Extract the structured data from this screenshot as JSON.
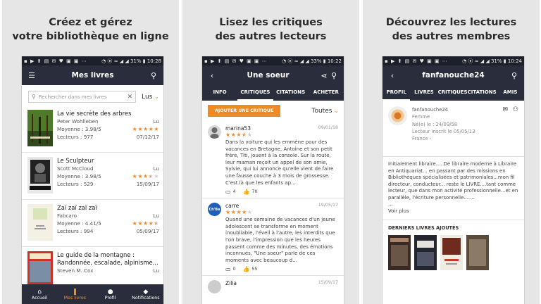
{
  "panels": [
    {
      "caption": [
        "Créez et gérez",
        "votre bibliothèque en ligne"
      ],
      "status": {
        "left": "▪ ▶ ⬆ ▤ ✉ ♥ ▣ ▣ ⋯",
        "right": "◔ ⦿ ≈ ◢ ◢ 31% ▮ 10:28"
      },
      "appbar_title": "Mes livres",
      "search_placeholder": "Rechercher dans mes livres",
      "filter": "Lus",
      "books": [
        {
          "title": "La vie secrète des arbres",
          "author": "Peter Wohlleben",
          "status": "Lu",
          "avg_label": "Moyenne : 3.98/5",
          "rating": 5,
          "readers_label": "Lecteurs : 977",
          "date": "07/12/17"
        },
        {
          "title": "Le Sculpteur",
          "author": "Scott McCloud",
          "status": "Lu",
          "avg_label": "Moyenne : 3.98/5",
          "rating": 3.5,
          "readers_label": "Lecteurs : 529",
          "date": "15/09/17"
        },
        {
          "title": "Zaï zaï zaï zaï",
          "author": "Fabcaro",
          "status": "Lu",
          "avg_label": "Moyenne : 4.41/5",
          "rating": 4.5,
          "readers_label": "Lecteurs : 994",
          "date": "05/09/17"
        },
        {
          "title": "Le guide de la montagne :",
          "title2": "Randonnée, escalade, alpinisme...",
          "author": "Steven M. Cox",
          "status": "Lu"
        }
      ],
      "nav": [
        {
          "icon": "⌂",
          "label": "Accueil"
        },
        {
          "icon": "❚",
          "label": "Mes livres"
        },
        {
          "icon": "●",
          "label": "Profil"
        },
        {
          "icon": "◆",
          "label": "Notifications"
        }
      ]
    },
    {
      "caption": [
        "Lisez les critiques",
        "des autres lecteurs"
      ],
      "status": {
        "left": "▪ ▶ ⬆ ▤ ✉ ♥ ▣ ▣ ⋯",
        "right": "◔ ⦿ ≈ ◢ ◢ 33% ▮ 10:22"
      },
      "appbar_title": "Une soeur",
      "tabs": [
        "INFO",
        "CRITIQUES",
        "CITATIONS",
        "ACHETER"
      ],
      "add_button": "AJOUTER UNE CRITIQUE",
      "filter": "Toutes",
      "reviews": [
        {
          "user": "marina53",
          "date": "09/01/18",
          "rating": 3.5,
          "text": "Dans la voiture qui les emmène pour des vacances en Bretagne, Antoine et son petit frère, Titi, jouent à la console. Sur la route, leur maman reçoit un appel de son amie, Sylvie, qui lui annonce qu'elle vient de faire une fausse couche à 3 mois de grossesse. C'est là que les enfants ap...",
          "comments": "4",
          "likes": "70"
        },
        {
          "user": "carre",
          "date": "19/05/17",
          "rating": 4,
          "avatar_text": "Ch'Ba",
          "text": "Quand une semaine de vacances d'un jeune adolescent se transforme en moment inoubliable, l'éveil à l'autre, les interdits que l'on brave, l'impression que les heures passent comme des minutes, des émotions inconnues, \"Une soeur\" parle de ces moments avec beaucoup d...",
          "comments": "0",
          "likes": "55"
        },
        {
          "user": "Zilia",
          "date": "15/09/17"
        }
      ]
    },
    {
      "caption": [
        "Découvrez les lectures",
        "des autres membres"
      ],
      "status": {
        "left": "▪ ▶ ⬆ ▤ ✉ ♥ ▣ ▣ ⋯",
        "right": "◔ ⦿ ≈ ◢ ◢ 31% ▮ 10:24"
      },
      "appbar_title": "fanfanouche24",
      "tabs": [
        "PROFIL",
        "LIVRES",
        "CRITIQUES",
        "CITATIONS",
        "AMIS"
      ],
      "profile": {
        "name": "fanfanouche24",
        "gender": "Femme",
        "born": "Né(e) le : 24/09/58",
        "since": "Lecteur inscrit le 05/05/13",
        "country": "France ›"
      },
      "bio": "Initialement libraire.... De libraire moderne à Libraire en Antiquariat... en passant par des missions en Bibliothèques spécialisées et patrimoniales...mon fil directeur, conducteur... reste le LIVRE....tant comme lecteur, que dans mon activité professionnelle...et en parallèle, l'écriture personnelle.......",
      "ellipsis": "...",
      "see_more": "Voir plus",
      "section_title": "DERNIERS LIVRES AJOUTÉS"
    }
  ],
  "colors": {
    "accent": "#f08a24",
    "bar": "#2a2d3c",
    "statusbar": "#1d1f2a",
    "panel_bg": "#e6e6e6"
  }
}
